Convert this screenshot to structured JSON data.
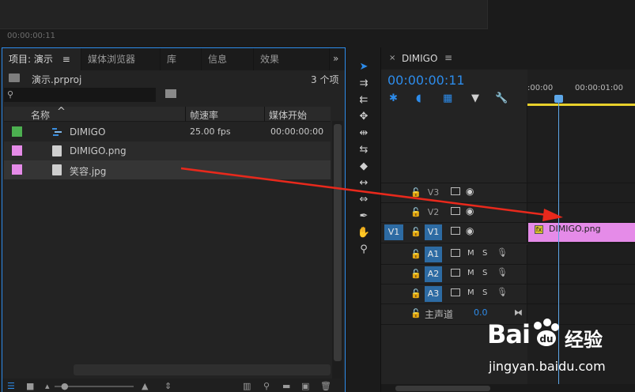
{
  "top_monitor": {
    "timecode": "00:00:00:11"
  },
  "project_panel": {
    "tabs": [
      "项目: 演示",
      "媒体浏览器",
      "库",
      "信息",
      "效果"
    ],
    "menu_glyph": "≡",
    "more_glyph": "»",
    "project_file": "演示.prproj",
    "item_count": "3 个项",
    "columns": {
      "name": "名称",
      "sort_glyph": "^",
      "frame_rate": "帧速率",
      "media_start": "媒体开始"
    },
    "items": [
      {
        "name": "DIMIGO",
        "color": "#4caf50",
        "frame_rate": "25.00 fps",
        "media_start": "00:00:00:00",
        "kind": "sequence"
      },
      {
        "name": "DIMIGO.png",
        "color": "#e58be8",
        "frame_rate": "",
        "media_start": "",
        "kind": "image"
      },
      {
        "name": "笑容.jpg",
        "color": "#e58be8",
        "frame_rate": "",
        "media_start": "",
        "kind": "image"
      }
    ]
  },
  "tools": [
    "selection-tool",
    "track-select-tool",
    "track-select-backward-tool",
    "ripple-edit-tool",
    "rolling-edit-tool",
    "rate-stretch-tool",
    "razor-tool",
    "slip-tool",
    "slide-tool",
    "pen-tool",
    "hand-tool",
    "zoom-tool"
  ],
  "timeline": {
    "close_glyph": "×",
    "sequence_name": "DIMIGO",
    "menu_glyph": "≡",
    "timecode": "00:00:00:11",
    "ruler": [
      ":00:00",
      "00:00:01:00"
    ],
    "video_tracks": [
      {
        "label": "V3",
        "source": "",
        "active": false
      },
      {
        "label": "V2",
        "source": "",
        "active": false
      },
      {
        "label": "V1",
        "source": "V1",
        "active": true
      }
    ],
    "audio_tracks": [
      {
        "label": "A1",
        "m": "M",
        "s": "S"
      },
      {
        "label": "A2",
        "m": "M",
        "s": "S"
      },
      {
        "label": "A3",
        "m": "M",
        "s": "S"
      }
    ],
    "master": {
      "label": "主声道",
      "value": "0.0"
    },
    "clip": {
      "fx": "fx",
      "name": "DIMIGO.png",
      "color": "#e58be8"
    }
  },
  "watermark": {
    "brand": "Bai",
    "brand2": "经验",
    "url": "jingyan.baidu.com"
  },
  "accent": "#2d8ceb"
}
